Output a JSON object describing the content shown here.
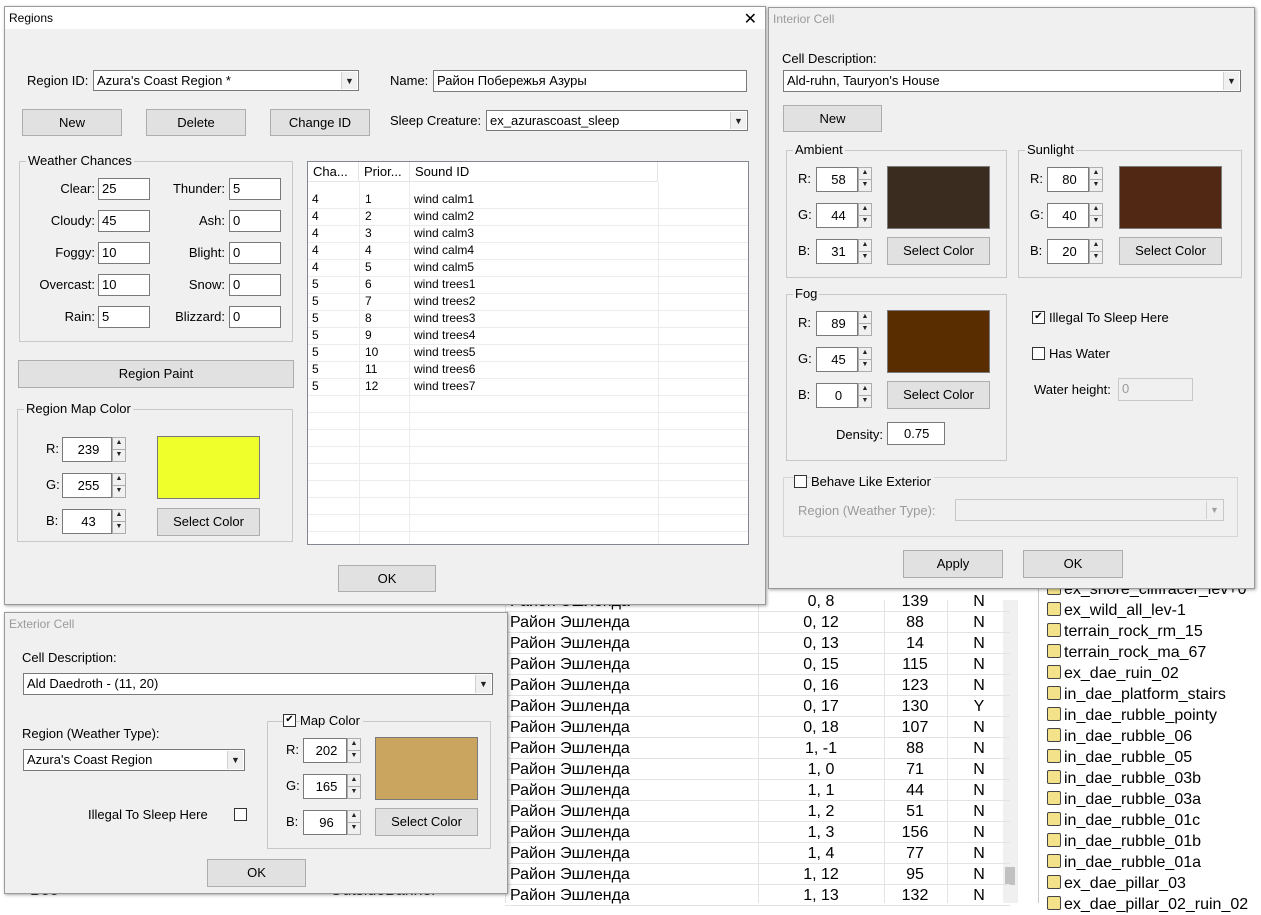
{
  "background_table": {
    "rows": [
      {
        "region": "Район Эшленда",
        "cell": "0, 8",
        "refs": "139",
        "flag": "N"
      },
      {
        "region": "Район Эшленда",
        "cell": "0, 12",
        "refs": "88",
        "flag": "N"
      },
      {
        "region": "Район Эшленда",
        "cell": "0, 13",
        "refs": "14",
        "flag": "N"
      },
      {
        "region": "Район Эшленда",
        "cell": "0, 15",
        "refs": "115",
        "flag": "N"
      },
      {
        "region": "Район Эшленда",
        "cell": "0, 16",
        "refs": "123",
        "flag": "N"
      },
      {
        "region": "Район Эшленда",
        "cell": "0, 17",
        "refs": "130",
        "flag": "Y"
      },
      {
        "region": "Район Эшленда",
        "cell": "0, 18",
        "refs": "107",
        "flag": "N"
      },
      {
        "region": "Район Эшленда",
        "cell": "1, -1",
        "refs": "88",
        "flag": "N"
      },
      {
        "region": "Район Эшленда",
        "cell": "1, 0",
        "refs": "71",
        "flag": "N"
      },
      {
        "region": "Район Эшленда",
        "cell": "1, 1",
        "refs": "44",
        "flag": "N"
      },
      {
        "region": "Район Эшленда",
        "cell": "1, 2",
        "refs": "51",
        "flag": "N"
      },
      {
        "region": "Район Эшленда",
        "cell": "1, 3",
        "refs": "156",
        "flag": "N"
      },
      {
        "region": "Район Эшленда",
        "cell": "1, 4",
        "refs": "77",
        "flag": "N"
      },
      {
        "region": "Район Эшленда",
        "cell": "1, 12",
        "refs": "95",
        "flag": "N"
      },
      {
        "region": "Район Эшленда",
        "cell": "1, 13",
        "refs": "132",
        "flag": "N"
      }
    ],
    "partial_left_texts": [
      "Bee",
      "OutsideBanner"
    ]
  },
  "object_list": {
    "items": [
      "ex_shore_cliffracer_lev+0",
      "ex_wild_all_lev-1",
      "terrain_rock_rm_15",
      "terrain_rock_ma_67",
      "ex_dae_ruin_02",
      "in_dae_platform_stairs",
      "in_dae_rubble_pointy",
      "in_dae_rubble_06",
      "in_dae_rubble_05",
      "in_dae_rubble_03b",
      "in_dae_rubble_03a",
      "in_dae_rubble_01c",
      "in_dae_rubble_01b",
      "in_dae_rubble_01a",
      "ex_dae_pillar_03",
      "ex_dae_pillar_02_ruin_02"
    ]
  },
  "regions": {
    "title": "Regions",
    "region_id_label": "Region ID:",
    "region_id_value": "Azura's Coast Region *",
    "name_label": "Name:",
    "name_value": "Район Побережья Азуры",
    "new_label": "New",
    "delete_label": "Delete",
    "change_id_label": "Change ID",
    "sleep_creature_label": "Sleep Creature:",
    "sleep_creature_value": "ex_azurascoast_sleep",
    "weather_chances_label": "Weather Chances",
    "weather": {
      "clear_label": "Clear:",
      "clear": "25",
      "cloudy_label": "Cloudy:",
      "cloudy": "45",
      "foggy_label": "Foggy:",
      "foggy": "10",
      "overcast_label": "Overcast:",
      "overcast": "10",
      "rain_label": "Rain:",
      "rain": "5",
      "thunder_label": "Thunder:",
      "thunder": "5",
      "ash_label": "Ash:",
      "ash": "0",
      "blight_label": "Blight:",
      "blight": "0",
      "snow_label": "Snow:",
      "snow": "0",
      "blizzard_label": "Blizzard:",
      "blizzard": "0"
    },
    "region_paint_label": "Region Paint",
    "region_map_color_label": "Region Map Color",
    "map_color": {
      "r_label": "R:",
      "r": "239",
      "g_label": "G:",
      "g": "255",
      "b_label": "B:",
      "b": "43",
      "swatch": "#efff2b"
    },
    "select_color_label": "Select Color",
    "sound_columns": [
      "Cha...",
      "Prior...",
      "Sound ID"
    ],
    "sounds": [
      {
        "chance": "4",
        "priority": "1",
        "sound": "wind calm1"
      },
      {
        "chance": "4",
        "priority": "2",
        "sound": "wind calm2"
      },
      {
        "chance": "4",
        "priority": "3",
        "sound": "wind calm3"
      },
      {
        "chance": "4",
        "priority": "4",
        "sound": "wind calm4"
      },
      {
        "chance": "4",
        "priority": "5",
        "sound": "wind calm5"
      },
      {
        "chance": "5",
        "priority": "6",
        "sound": "wind trees1"
      },
      {
        "chance": "5",
        "priority": "7",
        "sound": "wind trees2"
      },
      {
        "chance": "5",
        "priority": "8",
        "sound": "wind trees3"
      },
      {
        "chance": "5",
        "priority": "9",
        "sound": "wind trees4"
      },
      {
        "chance": "5",
        "priority": "10",
        "sound": "wind trees5"
      },
      {
        "chance": "5",
        "priority": "11",
        "sound": "wind trees6"
      },
      {
        "chance": "5",
        "priority": "12",
        "sound": "wind trees7"
      }
    ],
    "ok_label": "OK"
  },
  "interior": {
    "title": "Interior Cell",
    "cell_description_label": "Cell Description:",
    "cell_description": "Ald-ruhn, Tauryon's House",
    "new_label": "New",
    "ambient_label": "Ambient",
    "ambient": {
      "r": "58",
      "g": "44",
      "b": "31",
      "swatch": "#3a2c1f"
    },
    "sunlight_label": "Sunlight",
    "sunlight": {
      "r": "80",
      "g": "40",
      "b": "20",
      "swatch": "#502814"
    },
    "fog_label": "Fog",
    "fog": {
      "r": "89",
      "g": "45",
      "b": "0",
      "swatch": "#592d00"
    },
    "r_label": "R:",
    "g_label": "G:",
    "b_label": "B:",
    "select_color_label": "Select Color",
    "density_label": "Density:",
    "density": "0.75",
    "illegal_sleep_label": "Illegal To Sleep Here",
    "illegal_sleep_checked": "✔",
    "has_water_label": "Has Water",
    "water_height_label": "Water height:",
    "water_height": "0",
    "behave_exterior_label": "Behave Like Exterior",
    "region_weather_label": "Region (Weather Type):",
    "apply_label": "Apply",
    "ok_label": "OK"
  },
  "exterior": {
    "title": "Exterior Cell",
    "cell_description_label": "Cell Description:",
    "cell_description": "Ald Daedroth - (11, 20)",
    "region_weather_label": "Region (Weather Type):",
    "region_weather": "Azura's Coast Region",
    "map_color_label": "Map Color",
    "map_color_checked": "✔",
    "map_color": {
      "r_label": "R:",
      "r": "202",
      "g_label": "G:",
      "g": "165",
      "b_label": "B:",
      "b": "96",
      "swatch": "#caa560"
    },
    "select_color_label": "Select Color",
    "illegal_sleep_label": "Illegal To Sleep Here",
    "ok_label": "OK"
  }
}
